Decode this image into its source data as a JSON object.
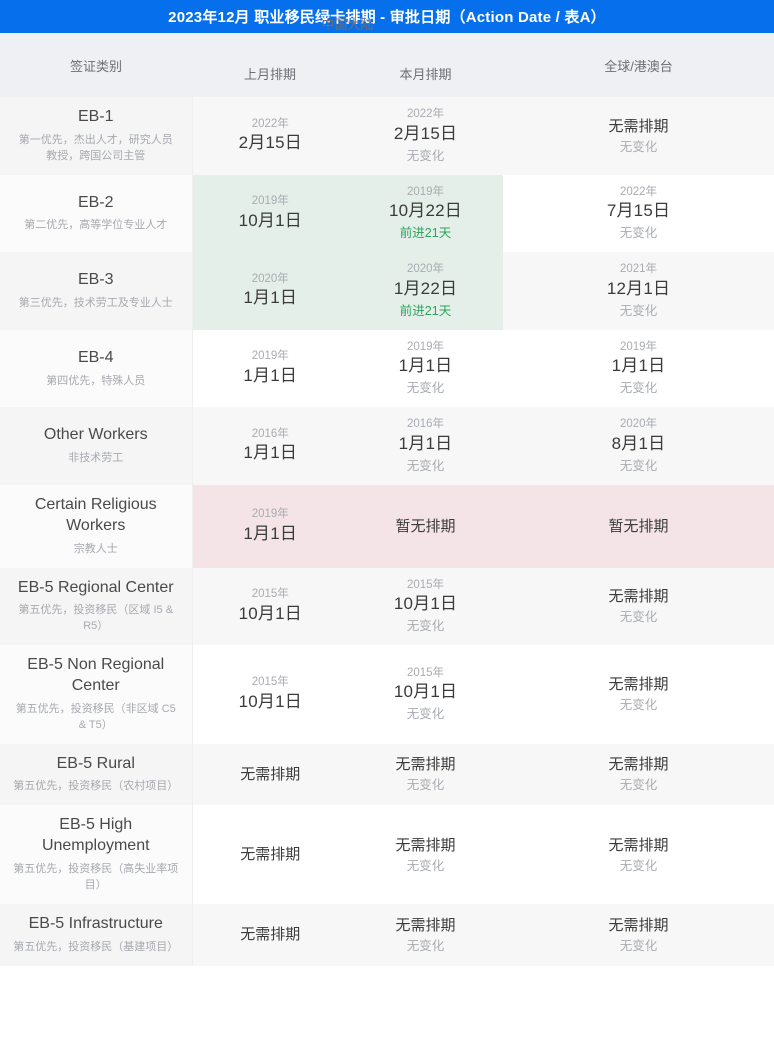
{
  "title": "2023年12月 职业移民绿卡排期 - 审批日期（Action Date / 表A）",
  "colors": {
    "title_bar": "#0670ec",
    "header_bg": "#eff0f4",
    "row_even_bg": "#f7f7f8",
    "advance_green": "#2ba35c",
    "highlight_green": "#e4efe9",
    "highlight_pink": "#f4e4e8"
  },
  "header": {
    "category": "签证类别",
    "group_china": "中国大陆",
    "prev_month": "上月排期",
    "curr_month": "本月排期",
    "global": "全球/港澳台"
  },
  "rows": [
    {
      "name": "EB-1",
      "desc": "第一优先，杰出人才，研究人员\n教授，跨国公司主管",
      "prev": {
        "year": "2022年",
        "day": "2月15日",
        "note": ""
      },
      "curr": {
        "year": "2022年",
        "day": "2月15日",
        "note": "无变化"
      },
      "global": {
        "year": "",
        "day": "无需排期",
        "note": "无变化"
      },
      "highlight": "none"
    },
    {
      "name": "EB-2",
      "desc": "第二优先，高等学位专业人才",
      "prev": {
        "year": "2019年",
        "day": "10月1日",
        "note": ""
      },
      "curr": {
        "year": "2019年",
        "day": "10月22日",
        "note": "前进21天"
      },
      "global": {
        "year": "2022年",
        "day": "7月15日",
        "note": "无变化"
      },
      "highlight": "green"
    },
    {
      "name": "EB-3",
      "desc": "第三优先，技术劳工及专业人士",
      "prev": {
        "year": "2020年",
        "day": "1月1日",
        "note": ""
      },
      "curr": {
        "year": "2020年",
        "day": "1月22日",
        "note": "前进21天"
      },
      "global": {
        "year": "2021年",
        "day": "12月1日",
        "note": "无变化"
      },
      "highlight": "green"
    },
    {
      "name": "EB-4",
      "desc": "第四优先，特殊人员",
      "prev": {
        "year": "2019年",
        "day": "1月1日",
        "note": ""
      },
      "curr": {
        "year": "2019年",
        "day": "1月1日",
        "note": "无变化"
      },
      "global": {
        "year": "2019年",
        "day": "1月1日",
        "note": "无变化"
      },
      "highlight": "none"
    },
    {
      "name": "Other Workers",
      "desc": "非技术劳工",
      "prev": {
        "year": "2016年",
        "day": "1月1日",
        "note": ""
      },
      "curr": {
        "year": "2016年",
        "day": "1月1日",
        "note": "无变化"
      },
      "global": {
        "year": "2020年",
        "day": "8月1日",
        "note": "无变化"
      },
      "highlight": "none"
    },
    {
      "name": "Certain Religious Workers",
      "desc": "宗教人士",
      "prev": {
        "year": "2019年",
        "day": "1月1日",
        "note": ""
      },
      "curr": {
        "year": "",
        "day": "暂无排期",
        "note": ""
      },
      "global": {
        "year": "",
        "day": "暂无排期",
        "note": ""
      },
      "highlight": "pink"
    },
    {
      "name": "EB-5 Regional Center",
      "desc": "第五优先，投资移民（区域 I5 & R5）",
      "prev": {
        "year": "2015年",
        "day": "10月1日",
        "note": ""
      },
      "curr": {
        "year": "2015年",
        "day": "10月1日",
        "note": "无变化"
      },
      "global": {
        "year": "",
        "day": "无需排期",
        "note": "无变化"
      },
      "highlight": "none"
    },
    {
      "name": "EB-5 Non Regional Center",
      "desc": "第五优先，投资移民（非区域 C5 & T5）",
      "prev": {
        "year": "2015年",
        "day": "10月1日",
        "note": ""
      },
      "curr": {
        "year": "2015年",
        "day": "10月1日",
        "note": "无变化"
      },
      "global": {
        "year": "",
        "day": "无需排期",
        "note": "无变化"
      },
      "highlight": "none"
    },
    {
      "name": "EB-5 Rural",
      "desc": "第五优先，投资移民（农村项目）",
      "prev": {
        "year": "",
        "day": "无需排期",
        "note": ""
      },
      "curr": {
        "year": "",
        "day": "无需排期",
        "note": "无变化"
      },
      "global": {
        "year": "",
        "day": "无需排期",
        "note": "无变化"
      },
      "highlight": "none"
    },
    {
      "name": "EB-5 High Unemployment",
      "desc": "第五优先，投资移民（高失业率项目）",
      "prev": {
        "year": "",
        "day": "无需排期",
        "note": ""
      },
      "curr": {
        "year": "",
        "day": "无需排期",
        "note": "无变化"
      },
      "global": {
        "year": "",
        "day": "无需排期",
        "note": "无变化"
      },
      "highlight": "none"
    },
    {
      "name": "EB-5 Infrastructure",
      "desc": "第五优先，投资移民（基建项目）",
      "prev": {
        "year": "",
        "day": "无需排期",
        "note": ""
      },
      "curr": {
        "year": "",
        "day": "无需排期",
        "note": "无变化"
      },
      "global": {
        "year": "",
        "day": "无需排期",
        "note": "无变化"
      },
      "highlight": "none"
    }
  ]
}
